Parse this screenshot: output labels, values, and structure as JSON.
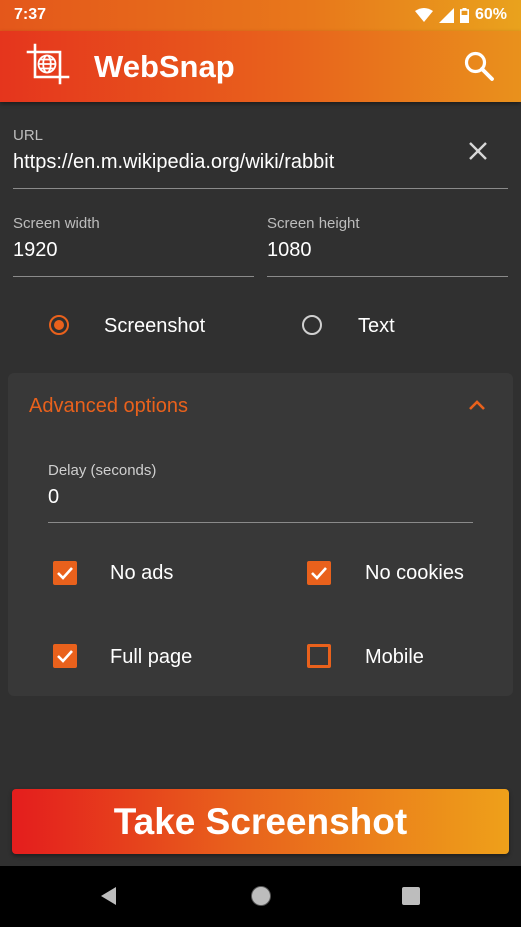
{
  "status_bar": {
    "time": "7:37",
    "battery": "60%"
  },
  "app_bar": {
    "title": "WebSnap"
  },
  "url_field": {
    "label": "URL",
    "value": "https://en.m.wikipedia.org/wiki/rabbit"
  },
  "screen_width": {
    "label": "Screen width",
    "value": "1920"
  },
  "screen_height": {
    "label": "Screen height",
    "value": "1080"
  },
  "capture_mode": {
    "options": [
      {
        "label": "Screenshot",
        "selected": true
      },
      {
        "label": "Text",
        "selected": false
      }
    ]
  },
  "advanced": {
    "title": "Advanced options",
    "expanded": true,
    "delay": {
      "label": "Delay (seconds)",
      "value": "0"
    },
    "options": [
      {
        "label": "No ads",
        "checked": true
      },
      {
        "label": "No cookies",
        "checked": true
      },
      {
        "label": "Full page",
        "checked": true
      },
      {
        "label": "Mobile",
        "checked": false
      }
    ]
  },
  "action": {
    "label": "Take Screenshot"
  },
  "colors": {
    "accent": "#e9611c",
    "background": "#303030",
    "card": "#383838"
  }
}
